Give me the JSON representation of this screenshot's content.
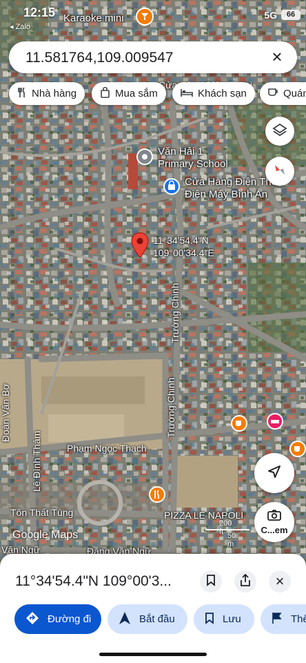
{
  "status_bar": {
    "time": "12:15",
    "back_app": "◂ Zalo",
    "network": "5G",
    "battery": "66"
  },
  "search": {
    "query": "11.581764,109.009547",
    "clear_icon": "close-icon"
  },
  "chips": [
    {
      "label": "Nhà hàng",
      "icon": "restaurant-icon"
    },
    {
      "label": "Mua sắm",
      "icon": "shopping-bag-icon"
    },
    {
      "label": "Khách sạn",
      "icon": "hotel-bed-icon"
    },
    {
      "label": "Quán",
      "icon": "cafe-cup-icon"
    }
  ],
  "map": {
    "top_poi": "Karaoke mini",
    "partial_label": "Cửa Hàng Điện Thoại",
    "school": [
      "Văn Hải 1",
      "Primary School"
    ],
    "store": [
      "Cửa Hàng Điện Thoại",
      "Điện Máy Bình An"
    ],
    "pin_coords": [
      "11°34'54.4\"N",
      "109°00'34.4\"E"
    ],
    "roads": {
      "truong_chinh_1": "Trường Chinh",
      "truong_chinh_2": "Trường Chinh",
      "pham_ngoc_thach": "Phạm Ngọc Thạch",
      "doan_van_bo": "Đoàn Văn Bơ",
      "le_dinh_tham": "Lê Đình Thám",
      "ton_that_tung": "Tôn Thất Tùng",
      "van_ngu": "Văn Ngữ",
      "dang_van_ngu": "Đặng Văn Ngữ",
      "pizza": "PIZZA LE NAPOLI"
    },
    "attribution": "Google Maps",
    "scale": {
      "ft": "200 ft",
      "m": "50 m"
    },
    "camera_label": "C...em",
    "accent_red": "#ea4335",
    "poi_orange": "#f57c00",
    "poi_pink": "#e91e63",
    "poi_blue": "#1a73e8"
  },
  "sheet": {
    "title": "11°34'54.4\"N 109°00'3...",
    "actions": [
      {
        "label": "Đường đi",
        "icon": "directions-icon"
      },
      {
        "label": "Bắt đầu",
        "icon": "navigation-arrow-icon"
      },
      {
        "label": "Lưu",
        "icon": "bookmark-icon"
      },
      {
        "label": "Thê",
        "icon": "flag-icon"
      }
    ],
    "primary_color": "#0b57d0",
    "secondary_bg": "#d3e3fd"
  }
}
